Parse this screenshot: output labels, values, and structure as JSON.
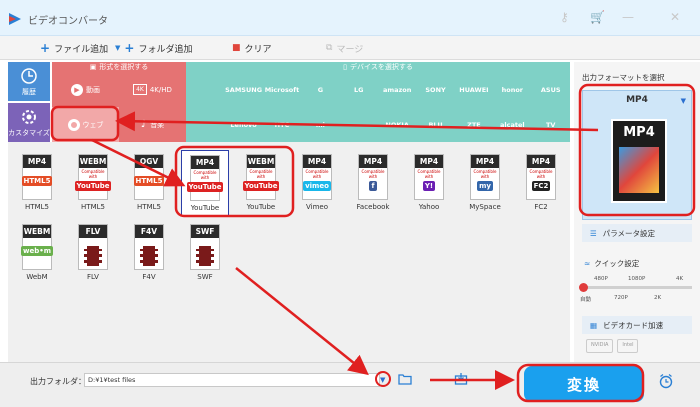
{
  "app": {
    "title": "ビデオコンバータ"
  },
  "toolbar": {
    "add_file": "ファイル追加",
    "add_folder": "フォルダ追加",
    "clear": "クリア",
    "merge": "マージ"
  },
  "leftnav": {
    "history": "履歴",
    "custom": "カスタマイズ"
  },
  "categories": {
    "format_header": "形式を選択する",
    "device_header": "デバイスを選択する",
    "video": "動画",
    "hd": "4K/HD",
    "web": "ウェブ",
    "audio": "音楽",
    "devices": [
      "",
      "SAMSUNG",
      "Microsoft",
      "G",
      "LG",
      "amazon",
      "SONY",
      "HUAWEI",
      "honor",
      "ASUS",
      "",
      "Lenovo",
      "HTC",
      "mi",
      "",
      "NOKIA",
      "BLU",
      "ZTE",
      "alcatel",
      "TV"
    ]
  },
  "formats": [
    {
      "top": "MP4",
      "sub": "",
      "logo": "HTML5",
      "logo_color": "#e44d26",
      "label": "HTML5"
    },
    {
      "top": "WEBM",
      "sub": "Compatible with",
      "logo": "YouTube",
      "logo_color": "#d22",
      "label": "HTML5"
    },
    {
      "top": "OGV",
      "sub": "",
      "logo": "HTML5",
      "logo_color": "#e44d26",
      "label": "HTML5"
    },
    {
      "top": "MP4",
      "sub": "Compatible with",
      "logo": "YouTube",
      "logo_color": "#d22",
      "label": "YouTube"
    },
    {
      "top": "WEBM",
      "sub": "Compatible with",
      "logo": "YouTube",
      "logo_color": "#d22",
      "label": "YouTube"
    },
    {
      "top": "MP4",
      "sub": "Compatible with",
      "logo": "vimeo",
      "logo_color": "#19b7ea",
      "label": "Vimeo"
    },
    {
      "top": "MP4",
      "sub": "Compatible with",
      "logo": "f",
      "logo_color": "#3b5998",
      "label": "Facebook"
    },
    {
      "top": "MP4",
      "sub": "Compatible with",
      "logo": "Y!",
      "logo_color": "#6b1fb3",
      "label": "Yahoo"
    },
    {
      "top": "MP4",
      "sub": "Compatible with",
      "logo": "my",
      "logo_color": "#3366aa",
      "label": "MySpace"
    },
    {
      "top": "MP4",
      "sub": "Compatible with",
      "logo": "FC2",
      "logo_color": "#222",
      "label": "FC2"
    },
    {
      "top": "WEBM",
      "sub": "",
      "logo": "web•m",
      "logo_color": "#6ab04c",
      "label": "WebM"
    },
    {
      "top": "FLV",
      "sub": "",
      "logo": "",
      "logo_color": "#7a1a1a",
      "label": "FLV"
    },
    {
      "top": "F4V",
      "sub": "",
      "logo": "",
      "logo_color": "#7a1a1a",
      "label": "F4V"
    },
    {
      "top": "SWF",
      "sub": "",
      "logo": "",
      "logo_color": "#7a1a1a",
      "label": "SWF"
    }
  ],
  "right_panel": {
    "title": "出力フォーマットを選択",
    "format_name": "MP4",
    "format_image_label": "MP4",
    "param_settings": "パラメータ設定",
    "quick_settings": "クイック設定",
    "slider_top": [
      "480P",
      "1080P",
      "4K"
    ],
    "slider_bottom": [
      "自動",
      "720P",
      "2K"
    ],
    "quality_level": 0,
    "gpu_accel": "ビデオカード加速",
    "gpu_badges": [
      "NVIDIA",
      "Intel"
    ]
  },
  "bottom": {
    "output_folder_label": "出力フォルダ：",
    "output_folder_value": "D:¥1¥test files",
    "convert": "変換"
  },
  "colors": {
    "accent": "#1aa0ee",
    "annotation_red": "#e02020",
    "format_cat_bg": "#e57373",
    "device_cat_bg": "#7fd1c6"
  }
}
